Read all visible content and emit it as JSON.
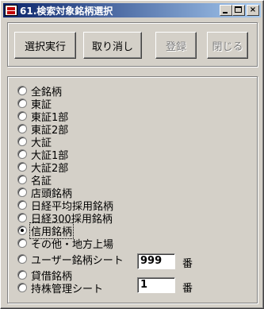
{
  "window": {
    "title": "61.検索対象銘柄選択",
    "caption": {
      "minimize": "_",
      "maximize": "□",
      "close": "×"
    }
  },
  "toolbar": {
    "execute_label": "選択実行",
    "cancel_label": "取り消し",
    "register_label": "登録",
    "close_label": "閉じる"
  },
  "options": {
    "selected": "信用銘柄",
    "items": [
      {
        "label": "全銘柄"
      },
      {
        "label": "東証"
      },
      {
        "label": "東証1部"
      },
      {
        "label": "東証2部"
      },
      {
        "label": "大証"
      },
      {
        "label": "大証1部"
      },
      {
        "label": "大証2部"
      },
      {
        "label": "名証"
      },
      {
        "label": "店頭銘柄"
      },
      {
        "label": "日経平均採用銘柄"
      },
      {
        "label": "日経300採用銘柄"
      },
      {
        "label": "信用銘柄"
      },
      {
        "label": "その他・地方上場"
      },
      {
        "label": "ユーザー銘柄シート"
      },
      {
        "label": "貸借銘柄"
      },
      {
        "label": "持株管理シート"
      }
    ],
    "user_sheet_number": "999",
    "holdings_sheet_number": "1",
    "number_suffix": "番"
  }
}
